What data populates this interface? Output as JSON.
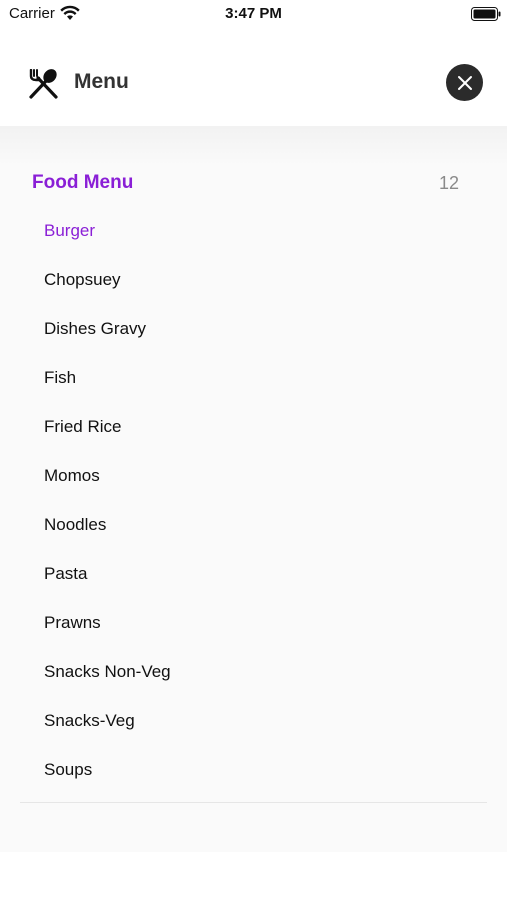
{
  "status_bar": {
    "carrier": "Carrier",
    "time": "3:47 PM"
  },
  "header": {
    "title": "Menu",
    "icon": "fork-spoon-icon",
    "close_icon": "close-icon"
  },
  "section": {
    "title": "Food Menu",
    "count": "12"
  },
  "items": [
    {
      "label": "Burger"
    },
    {
      "label": "Chopsuey"
    },
    {
      "label": "Dishes Gravy"
    },
    {
      "label": "Fish"
    },
    {
      "label": "Fried Rice"
    },
    {
      "label": "Momos"
    },
    {
      "label": "Noodles"
    },
    {
      "label": "Pasta"
    },
    {
      "label": "Prawns"
    },
    {
      "label": "Snacks Non-Veg"
    },
    {
      "label": "Snacks-Veg"
    },
    {
      "label": "Soups"
    }
  ],
  "selected_item": "Burger",
  "colors": {
    "accent": "#8a1fd6",
    "close_bg": "#2b2b2b",
    "count_gray": "#8a8a8a"
  }
}
